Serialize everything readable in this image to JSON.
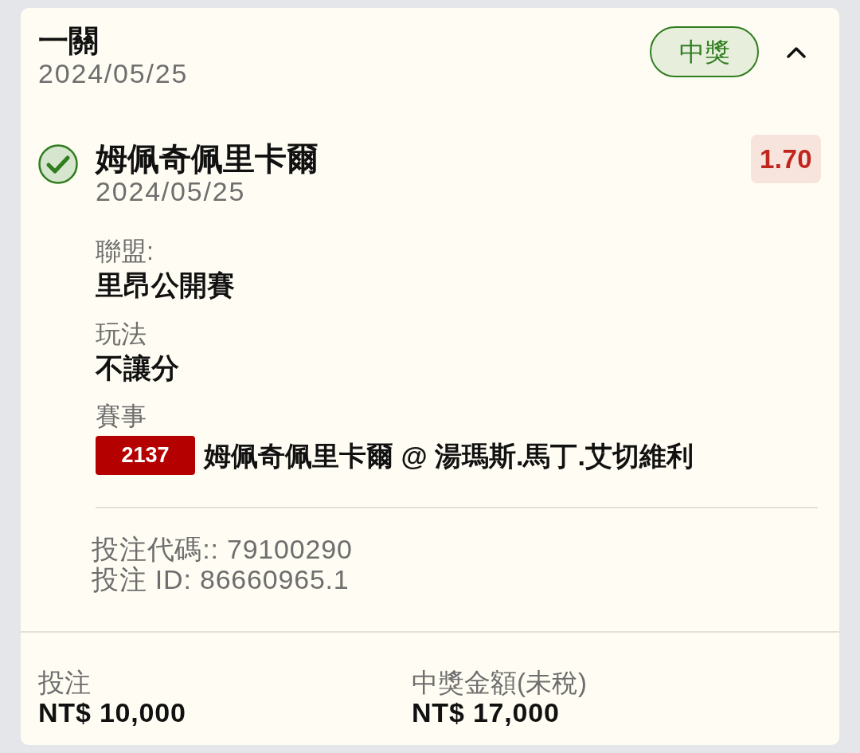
{
  "bet": {
    "title": "一關",
    "date": "2024/05/25",
    "status": {
      "label": "中獎",
      "kind": "won"
    },
    "expanded": true,
    "selections": [
      {
        "won": true,
        "name": "姆佩奇佩里卡爾",
        "date": "2024/05/25",
        "odds": "1.70",
        "fields": [
          {
            "label": "聯盟:",
            "value": "里昂公開賽"
          },
          {
            "label": "玩法",
            "value": "不讓分"
          }
        ],
        "event": {
          "label": "賽事",
          "code": "2137",
          "name": "姆佩奇佩里卡爾 @ 湯瑪斯.馬丁.艾切維利"
        },
        "references": [
          "投注代碼:: 79100290",
          "投注 ID: 86660965.1"
        ]
      }
    ],
    "totals": [
      {
        "label": "投注",
        "value": "NT$ 10,000"
      },
      {
        "label": "中獎金額(未稅)",
        "value": "NT$ 17,000"
      }
    ]
  }
}
